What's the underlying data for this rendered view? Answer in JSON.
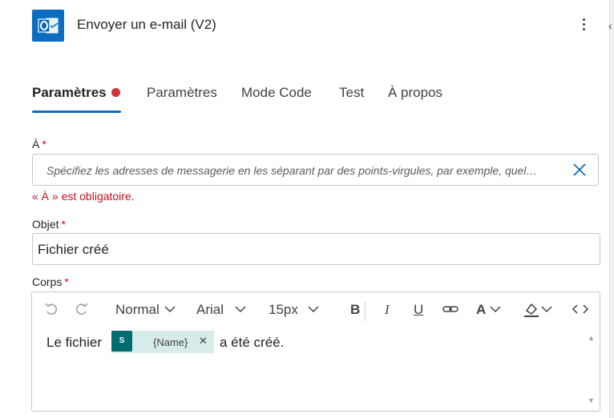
{
  "header": {
    "title": "Envoyer un e-mail (V2)",
    "icon": "outlook-icon",
    "brand_color": "#0a6dc2"
  },
  "tabs": [
    {
      "label": "Paramètres",
      "active": true,
      "has_error": true
    },
    {
      "label": "Paramètres",
      "active": false
    },
    {
      "label": "Mode Code",
      "active": false
    },
    {
      "label": "Test",
      "active": false
    },
    {
      "label": "À propos",
      "active": false
    }
  ],
  "form": {
    "to": {
      "label": "À",
      "required": "*",
      "placeholder": "Spécifiez les adresses de messagerie en les séparant par des points-virgules, par exemple, quel…",
      "error": "« À » est obligatoire."
    },
    "subject": {
      "label": "Objet",
      "required": "*",
      "value": "Fichier créé"
    },
    "body": {
      "label": "Corps",
      "required": "*",
      "toolbar": {
        "style": "Normal",
        "font": "Arial",
        "size": "15px",
        "bold": "B",
        "italic": "I",
        "underline": "U",
        "font_color": "A"
      },
      "content_before": "Le fichier",
      "token": {
        "label": "{Name}",
        "icon": "sharepoint-icon",
        "color": "#036c70"
      },
      "content_after": "a été créé."
    }
  },
  "colors": {
    "accent": "#0f6cbd",
    "error": "#c50f1f"
  }
}
